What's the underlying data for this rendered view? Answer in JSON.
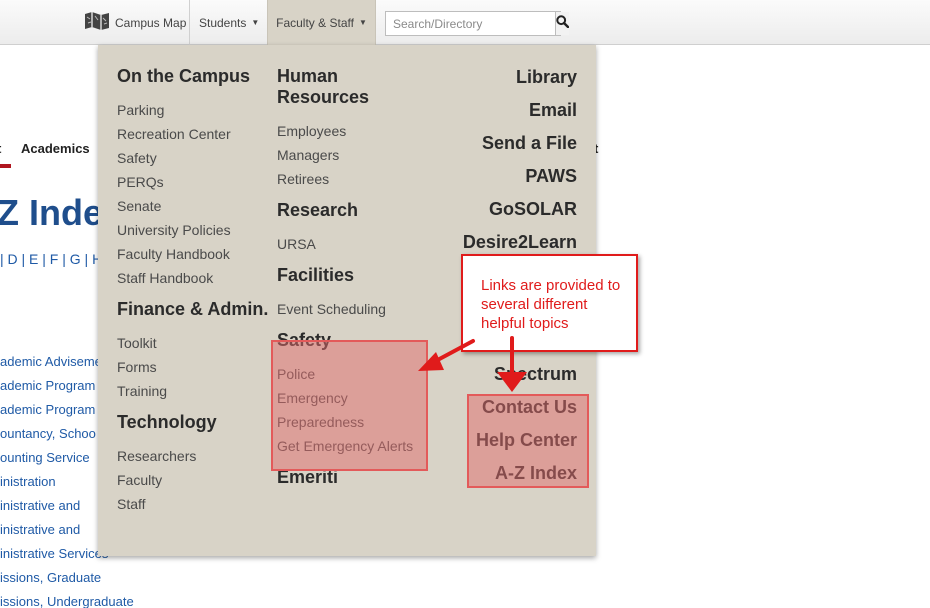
{
  "topbar": {
    "campus_map": "Campus Map",
    "students": "Students",
    "faculty_staff": "Faculty & Staff",
    "search_placeholder": "Search/Directory"
  },
  "background_page": {
    "nav_left": "t",
    "nav_academics": "Academics",
    "nav_right": "t",
    "title": "Z Inde",
    "letters": "| D | E | F | G | H",
    "links": [
      "ademic Adviseme",
      "ademic Program",
      "ademic Program",
      "ountancy, Schoo",
      "ounting Service",
      "inistration",
      "inistrative and",
      "inistrative and",
      "inistrative Services",
      "issions, Graduate",
      "issions, Undergraduate"
    ]
  },
  "menu": {
    "col1": {
      "on_campus": {
        "heading": "On the Campus",
        "items": [
          "Parking",
          "Recreation Center",
          "Safety",
          "PERQs",
          "Senate",
          "University Policies",
          "Faculty Handbook",
          "Staff Handbook"
        ]
      },
      "finance": {
        "heading": "Finance & Admin.",
        "items": [
          "Toolkit",
          "Forms",
          "Training"
        ]
      },
      "technology": {
        "heading": "Technology",
        "items": [
          "Researchers",
          "Faculty",
          "Staff"
        ]
      }
    },
    "col2": {
      "hr": {
        "heading_1": "Human",
        "heading_2": "Resources",
        "items": [
          "Employees",
          "Managers",
          "Retirees"
        ]
      },
      "research": {
        "heading": "Research",
        "items": [
          "URSA"
        ]
      },
      "facilities": {
        "heading": "Facilities",
        "items": [
          "Event Scheduling"
        ]
      },
      "safety": {
        "heading": "Safety",
        "items": [
          "Police",
          "Emergency",
          "Preparedness",
          "Get Emergency Alerts"
        ]
      },
      "emeriti": {
        "heading": "Emeriti"
      }
    },
    "col3": {
      "top": [
        "Library",
        "Email",
        "Send a File",
        "PAWS",
        "GoSOLAR",
        "Desire2Learn"
      ],
      "spectrum": "Spectrum",
      "bottom": [
        "Contact Us",
        "Help Center",
        "A-Z Index"
      ]
    }
  },
  "annotation": {
    "callout": "Links are provided to several different helpful topics",
    "color": "#e01b1b"
  }
}
